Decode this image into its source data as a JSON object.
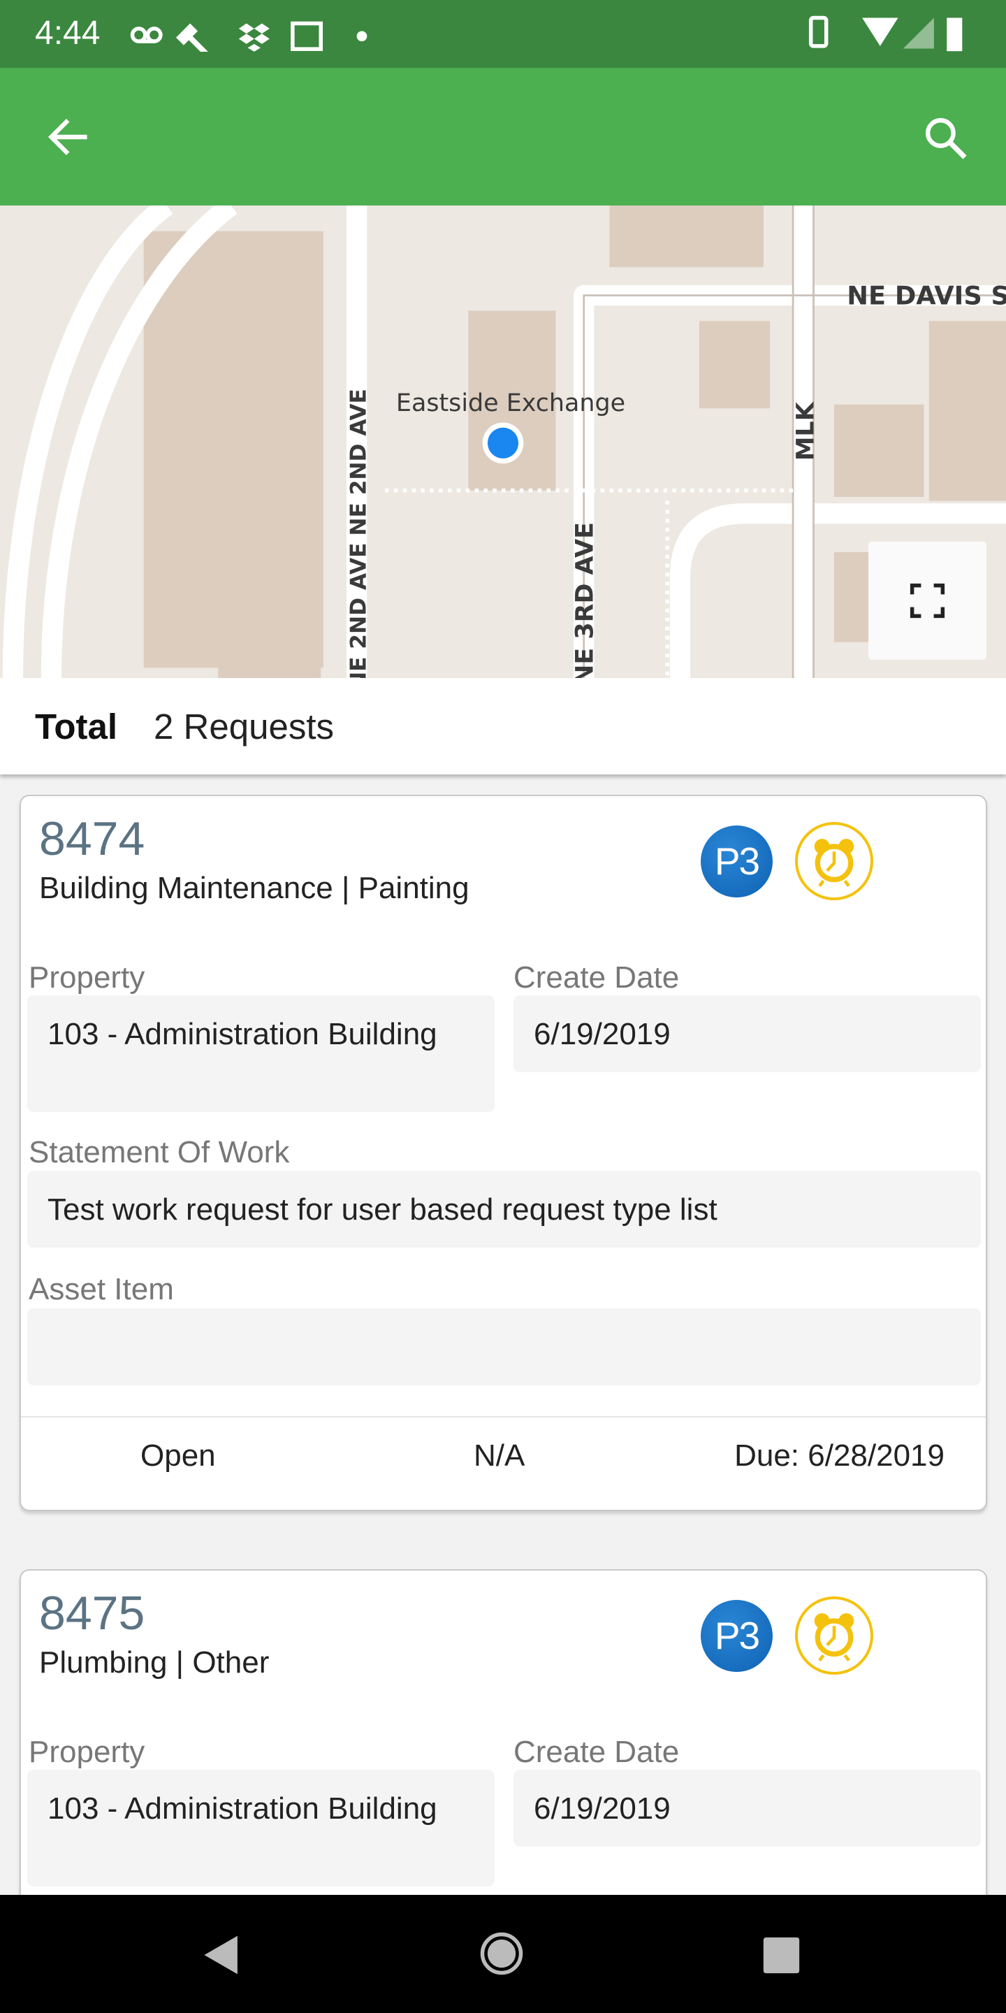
{
  "status_bar": {
    "time": "4:44",
    "icons": [
      "voicemail-icon",
      "wrench-icon",
      "dropbox-icon",
      "calendar-icon",
      "dot-icon",
      "vibrate-icon",
      "wifi-icon",
      "signal-icon",
      "battery-charging-icon"
    ]
  },
  "app_bar": {
    "back_icon": "arrow-left-icon",
    "search_icon": "search-icon",
    "color": "#4caf50"
  },
  "map": {
    "place_label": "Eastside Exchange",
    "streets": [
      "NE DAVIS S",
      "NE 2ND AVE",
      "NE 2ND AVE",
      "NE 3RD AVE",
      "MLK"
    ],
    "fullscreen_icon": "fullscreen-icon"
  },
  "summary": {
    "label": "Total",
    "value": "2 Requests"
  },
  "requests": [
    {
      "id": "8474",
      "category": "Building Maintenance | Painting",
      "priority": "P3",
      "property_label": "Property",
      "property": "103 - Administration Building",
      "create_date_label": "Create Date",
      "create_date": "6/19/2019",
      "sow_label": "Statement Of Work",
      "sow": "Test work request for user based request type list",
      "asset_label": "Asset Item",
      "asset": "",
      "status": "Open",
      "assignee": "N/A",
      "due": "Due: 6/28/2019"
    },
    {
      "id": "8475",
      "category": "Plumbing | Other",
      "priority": "P3",
      "property_label": "Property",
      "property": "103 - Administration Building",
      "create_date_label": "Create Date",
      "create_date": "6/19/2019"
    }
  ],
  "colors": {
    "status_bar": "#3b873f",
    "priority": "#1a73c4",
    "alarm": "#f4c20d",
    "request_id": "#5b7383"
  }
}
